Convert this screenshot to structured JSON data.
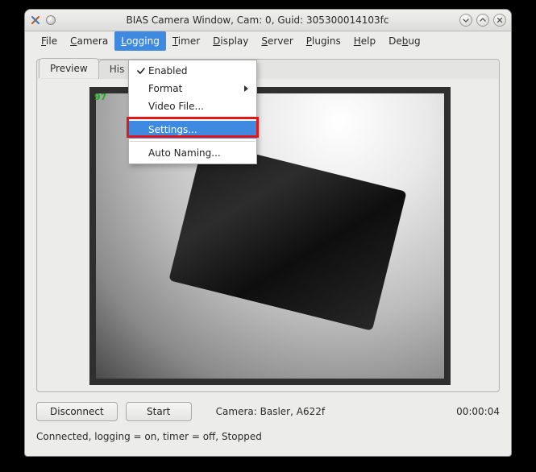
{
  "titlebar": {
    "title": "BIAS Camera Window, Cam: 0, Guid: 305300014103fc"
  },
  "menubar": {
    "file": "File",
    "file_ul": "F",
    "camera": "Camera",
    "camera_ul": "C",
    "logging": "Logging",
    "logging_ul": "L",
    "timer": "Timer",
    "timer_ul": "T",
    "display": "Display",
    "display_ul": "D",
    "server": "Server",
    "server_ul": "S",
    "plugins": "Plugins",
    "plugins_ul": "P",
    "help": "Help",
    "help_ul": "H",
    "debug": "Debug",
    "debug_ul": "b"
  },
  "tabs": {
    "preview": "Preview",
    "histogram": "Histogram",
    "histogram_short": "His"
  },
  "preview": {
    "fps": "97"
  },
  "logging_menu": {
    "enabled": "Enabled",
    "format": "Format",
    "video_file": "Video File...",
    "settings": "Settings...",
    "auto_naming": "Auto Naming..."
  },
  "bottom": {
    "disconnect": "Disconnect",
    "start": "Start",
    "camera_label": "Camera:  Basler,  A622f",
    "timecode": "00:00:04"
  },
  "status": "Connected, logging = on, timer = off, Stopped"
}
